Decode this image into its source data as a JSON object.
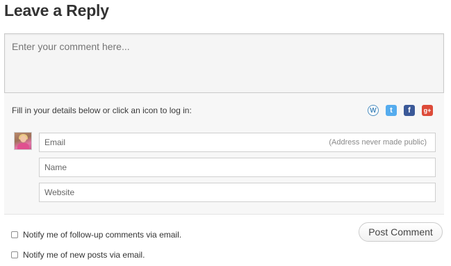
{
  "reply": {
    "title": "Leave a Reply",
    "comment_placeholder": "Enter your comment here..."
  },
  "login": {
    "prompt": "Fill in your details below or click an icon to log in:",
    "icons": [
      {
        "name": "wordpress-icon",
        "glyph": "W",
        "color": "#4f8fc0"
      },
      {
        "name": "twitter-icon",
        "glyph": "t",
        "color": "#55acee"
      },
      {
        "name": "facebook-icon",
        "glyph": "f",
        "color": "#3b5998"
      },
      {
        "name": "google-plus-icon",
        "glyph": "g+",
        "color": "#dd4b39"
      }
    ]
  },
  "fields": {
    "email_placeholder": "Email",
    "email_note": "(Address never made public)",
    "name_placeholder": "Name",
    "website_placeholder": "Website"
  },
  "actions": {
    "post_label": "Post Comment"
  },
  "notifications": {
    "followup_label": "Notify me of follow-up comments via email.",
    "new_posts_label": "Notify me of new posts via email."
  }
}
